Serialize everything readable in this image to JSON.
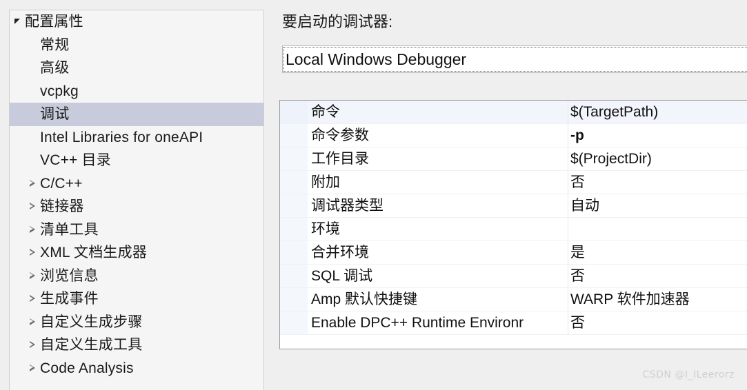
{
  "tree": {
    "items": [
      {
        "label": "配置属性",
        "indent": 0,
        "toggle": "expanded",
        "selected": false
      },
      {
        "label": "常规",
        "indent": 1,
        "toggle": "none",
        "selected": false
      },
      {
        "label": "高级",
        "indent": 1,
        "toggle": "none",
        "selected": false
      },
      {
        "label": "vcpkg",
        "indent": 1,
        "toggle": "none",
        "selected": false
      },
      {
        "label": "调试",
        "indent": 1,
        "toggle": "none",
        "selected": true
      },
      {
        "label": "Intel Libraries for oneAPI",
        "indent": 1,
        "toggle": "none",
        "selected": false
      },
      {
        "label": "VC++ 目录",
        "indent": 1,
        "toggle": "none",
        "selected": false
      },
      {
        "label": "C/C++",
        "indent": 1,
        "toggle": "collapsed",
        "selected": false
      },
      {
        "label": "链接器",
        "indent": 1,
        "toggle": "collapsed",
        "selected": false
      },
      {
        "label": "清单工具",
        "indent": 1,
        "toggle": "collapsed",
        "selected": false
      },
      {
        "label": "XML 文档生成器",
        "indent": 1,
        "toggle": "collapsed",
        "selected": false
      },
      {
        "label": "浏览信息",
        "indent": 1,
        "toggle": "collapsed",
        "selected": false
      },
      {
        "label": "生成事件",
        "indent": 1,
        "toggle": "collapsed",
        "selected": false
      },
      {
        "label": "自定义生成步骤",
        "indent": 1,
        "toggle": "collapsed",
        "selected": false
      },
      {
        "label": "自定义生成工具",
        "indent": 1,
        "toggle": "collapsed",
        "selected": false
      },
      {
        "label": "Code Analysis",
        "indent": 1,
        "toggle": "collapsed",
        "selected": false
      }
    ]
  },
  "debugger": {
    "label": "要启动的调试器:",
    "selected_value": "Local Windows Debugger"
  },
  "properties": {
    "rows": [
      {
        "name": "命令",
        "value": "$(TargetPath)",
        "bold": false
      },
      {
        "name": "命令参数",
        "value": "-p",
        "bold": true
      },
      {
        "name": "工作目录",
        "value": "$(ProjectDir)",
        "bold": false
      },
      {
        "name": "附加",
        "value": "否",
        "bold": false
      },
      {
        "name": "调试器类型",
        "value": "自动",
        "bold": false
      },
      {
        "name": "环境",
        "value": "",
        "bold": false
      },
      {
        "name": "合并环境",
        "value": "是",
        "bold": false
      },
      {
        "name": "SQL 调试",
        "value": "否",
        "bold": false
      },
      {
        "name": "Amp 默认快捷键",
        "value": "WARP 软件加速器",
        "bold": false
      },
      {
        "name": "Enable DPC++ Runtime Environr",
        "value": "否",
        "bold": false
      }
    ]
  },
  "watermark": {
    "text": "CSDN @I_ILeerorz"
  }
}
